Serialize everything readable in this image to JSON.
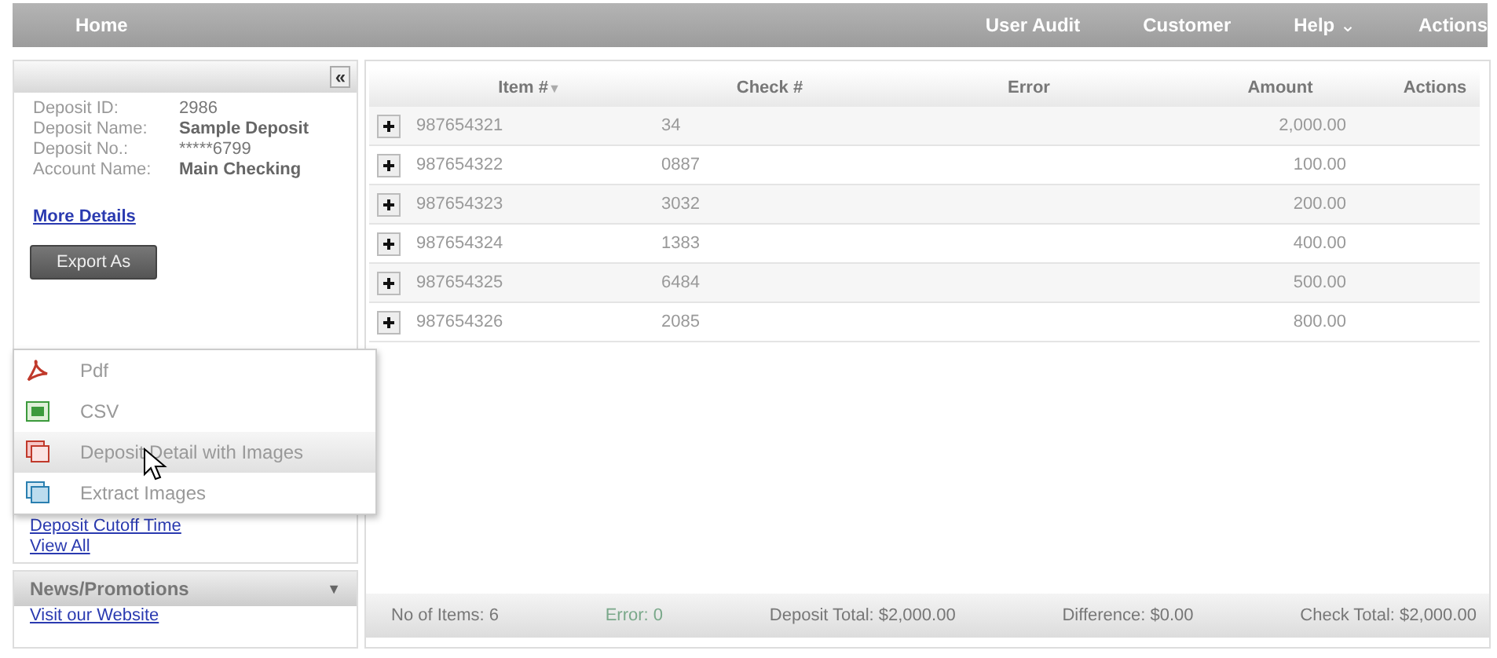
{
  "nav": {
    "left": [
      {
        "label": "Home"
      }
    ],
    "right": [
      {
        "label": "User Audit"
      },
      {
        "label": "Customer"
      },
      {
        "label": "Help",
        "caret": "⌄"
      },
      {
        "label": "Actions"
      }
    ]
  },
  "sidebar": {
    "collapse": "«",
    "fields": [
      {
        "label": "Deposit ID:",
        "value": "2986",
        "bold": false
      },
      {
        "label": "Deposit Name:",
        "value": "Sample Deposit",
        "bold": true
      },
      {
        "label": "Deposit No.:",
        "value": "*****6799",
        "bold": false
      },
      {
        "label": "Account Name:",
        "value": "Main Checking",
        "bold": true
      }
    ],
    "more_link": "More Details",
    "export_button": "Export As",
    "links": [
      "Deposit Cutoff Time",
      "View All"
    ],
    "news": {
      "title": "News/Promotions",
      "toggle": "▼",
      "links": [
        "Visit our Website"
      ]
    }
  },
  "export_menu": [
    {
      "label": "Pdf",
      "kind": "pdf",
      "selected": false
    },
    {
      "label": "CSV",
      "kind": "csv",
      "selected": false
    },
    {
      "label": "Deposit Detail with Images",
      "kind": "images",
      "selected": true
    },
    {
      "label": "Extract Images",
      "kind": "extract",
      "selected": false
    }
  ],
  "table": {
    "columns": [
      "Item #",
      "Check #",
      "Error",
      "Amount",
      "Actions"
    ],
    "sort_caret": "▼",
    "rows": [
      {
        "item": "987654321",
        "check": "34",
        "amount": "2,000.00"
      },
      {
        "item": "987654322",
        "check": "0887",
        "amount": "100.00"
      },
      {
        "item": "987654323",
        "check": "3032",
        "amount": "200.00"
      },
      {
        "item": "987654324",
        "check": "1383",
        "amount": "400.00"
      },
      {
        "item": "987654325",
        "check": "6484",
        "amount": "500.00"
      },
      {
        "item": "987654326",
        "check": "2085",
        "amount": "800.00"
      }
    ]
  },
  "footer": [
    {
      "text": "No of Items: 6",
      "kind": "plain"
    },
    {
      "text": "Error: 0",
      "kind": "error"
    },
    {
      "text": "Deposit Total: $2,000.00",
      "kind": "plain"
    },
    {
      "text": "Difference: $0.00",
      "kind": "plain"
    },
    {
      "text": "Check Total: $2,000.00",
      "kind": "plain"
    }
  ]
}
